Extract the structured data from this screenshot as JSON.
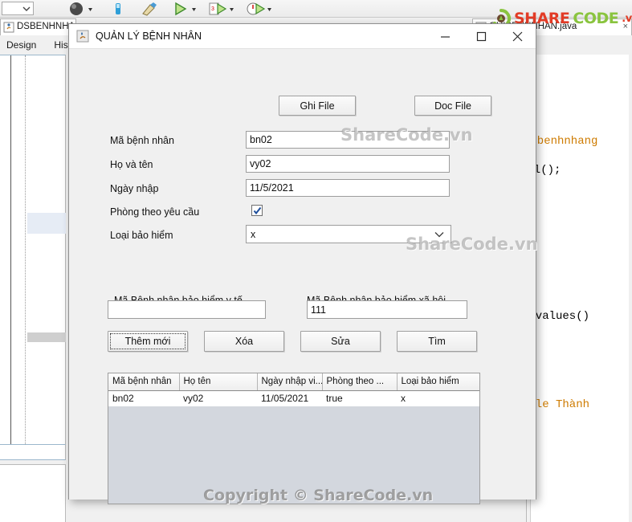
{
  "ide": {
    "toolbar": {
      "icons": [
        "dropdown-combo",
        "build-icon",
        "clean-icon",
        "run-icon",
        "debug-file-icon",
        "profile-icon"
      ]
    },
    "tabs": [
      {
        "label": "DSBENHNHAN.j",
        "icon": "java-file-icon"
      },
      {
        "label": "GUIBENHNHAN.java",
        "icon": "java-file-icon",
        "close": "×"
      }
    ],
    "subtabs": [
      "Design",
      "Histor"
    ],
    "code_lines": [
      {
        "text": "ĐLbenhnhang",
        "color": "brown"
      },
      {
        "text": "del();",
        "color": "black"
      },
      {
        "text": ").values()",
        "color": "black"
      },
      {
        "text": "File Thành",
        "color": "brown"
      }
    ]
  },
  "logo": {
    "share": "SHARE",
    "code": "CODE",
    "vn": ".vn"
  },
  "watermarks": {
    "wm1": "ShareCode.vn",
    "wm2": "ShareCode.vn",
    "footer": "Copyright © ShareCode.vn"
  },
  "dialog": {
    "title": "QUẢN LÝ BỆNH NHÂN",
    "window_buttons": {
      "minimize": "minimize-icon",
      "maximize": "maximize-icon",
      "close": "close-icon"
    },
    "file_buttons": {
      "write": "Ghi File",
      "read": "Doc File"
    },
    "fields": [
      {
        "label": "Mã bệnh nhân",
        "value": "bn02",
        "placeholder": ""
      },
      {
        "label": "Họ và tên",
        "value": "vy02",
        "placeholder": ""
      },
      {
        "label": "Ngày nhập",
        "value": "11/5/2021",
        "placeholder": ""
      }
    ],
    "checkbox": {
      "label": "Phòng theo yêu cầu",
      "checked": true
    },
    "combo": {
      "label": "Loại bảo hiểm",
      "value": "x",
      "options": [
        "x"
      ]
    },
    "insurance": {
      "health": {
        "label": "Mã Bệnh nhân bảo hiểm y tế",
        "value": "",
        "placeholder": ""
      },
      "social": {
        "label": "Mã Bệnh nhân bảo hiểm xã hội",
        "value": "111",
        "placeholder": ""
      }
    },
    "actions": [
      {
        "label": "Thêm mới",
        "focused": true
      },
      {
        "label": "Xóa",
        "focused": false
      },
      {
        "label": "Sửa",
        "focused": false
      },
      {
        "label": "Tìm",
        "focused": false
      }
    ],
    "table": {
      "columns": [
        "Mã bệnh nhân",
        "Họ tên",
        "Ngày nhập vi...",
        "Phòng theo ...",
        "Loại bảo hiểm"
      ],
      "rows": [
        [
          "bn02",
          "vy02",
          "11/05/2021",
          "true",
          "x"
        ]
      ]
    }
  },
  "colors": {
    "dialog_bg": "#f0f0f0",
    "table_viewport": "#d3d7de",
    "accent_green": "#8ac43f",
    "accent_red": "#e23b26",
    "code_brown": "#ce7b00",
    "highlight_line": "#e6ecf5"
  }
}
